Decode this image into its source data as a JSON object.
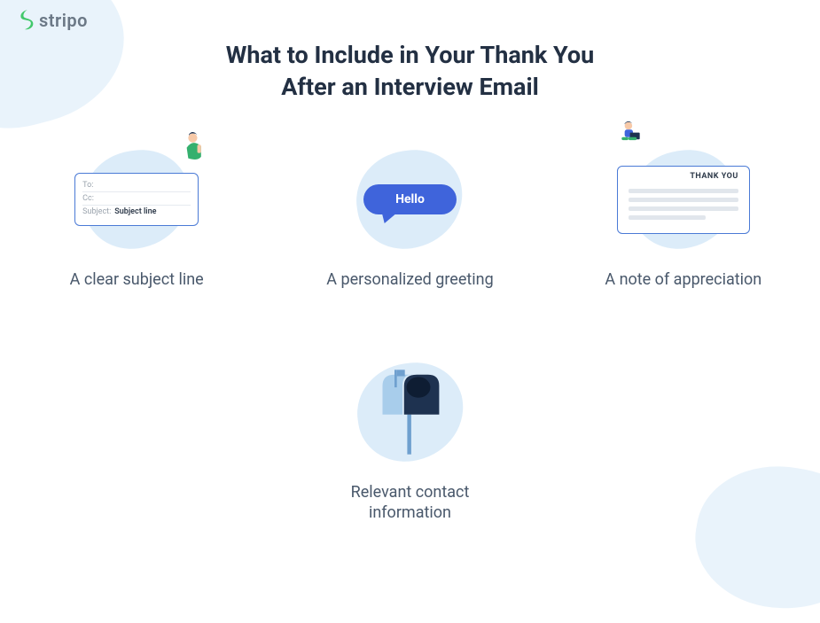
{
  "brand": {
    "name": "stripo"
  },
  "title_line1": "What to Include in Your Thank You",
  "title_line2": "After an Interview Email",
  "cards": {
    "subject": {
      "caption": "A clear subject line",
      "fields": {
        "to_label": "To:",
        "cc_label": "Cc:",
        "subject_label": "Subject:",
        "subject_value": "Subject line"
      }
    },
    "greeting": {
      "caption": "A personalized greeting",
      "bubble_text": "Hello"
    },
    "appreciation": {
      "caption": "A note of appreciation",
      "note_heading": "THANK YOU"
    },
    "contact": {
      "caption_line1": "Relevant contact",
      "caption_line2": "information"
    }
  },
  "colors": {
    "brand_green": "#41c86b",
    "accent_blue": "#3f64db",
    "outline_blue": "#4a7ad6",
    "blob": "#dcecf9"
  }
}
